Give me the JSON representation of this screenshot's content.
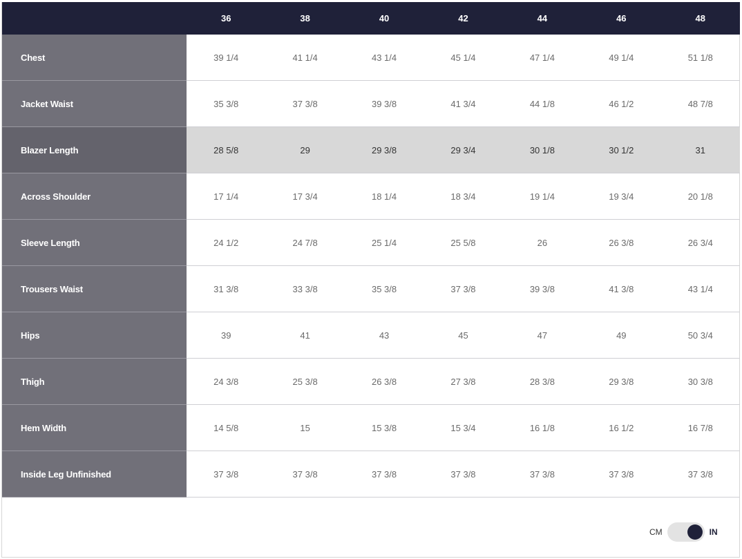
{
  "sizes": [
    "36",
    "38",
    "40",
    "42",
    "44",
    "46",
    "48"
  ],
  "rows": [
    {
      "label": "Chest",
      "values": [
        "39 1/4",
        "41 1/4",
        "43 1/4",
        "45 1/4",
        "47 1/4",
        "49 1/4",
        "51 1/8"
      ]
    },
    {
      "label": "Jacket Waist",
      "values": [
        "35 3/8",
        "37 3/8",
        "39 3/8",
        "41 3/4",
        "44 1/8",
        "46 1/2",
        "48 7/8"
      ]
    },
    {
      "label": "Blazer Length",
      "values": [
        "28 5/8",
        "29",
        "29 3/8",
        "29 3/4",
        "30 1/8",
        "30 1/2",
        "31"
      ]
    },
    {
      "label": "Across Shoulder",
      "values": [
        "17 1/4",
        "17 3/4",
        "18 1/4",
        "18 3/4",
        "19 1/4",
        "19 3/4",
        "20 1/8"
      ]
    },
    {
      "label": "Sleeve Length",
      "values": [
        "24 1/2",
        "24 7/8",
        "25 1/4",
        "25 5/8",
        "26",
        "26 3/8",
        "26 3/4"
      ]
    },
    {
      "label": "Trousers Waist",
      "values": [
        "31 3/8",
        "33 3/8",
        "35 3/8",
        "37 3/8",
        "39 3/8",
        "41 3/8",
        "43 1/4"
      ]
    },
    {
      "label": "Hips",
      "values": [
        "39",
        "41",
        "43",
        "45",
        "47",
        "49",
        "50 3/4"
      ]
    },
    {
      "label": "Thigh",
      "values": [
        "24 3/8",
        "25 3/8",
        "26 3/8",
        "27 3/8",
        "28 3/8",
        "29 3/8",
        "30 3/8"
      ]
    },
    {
      "label": "Hem Width",
      "values": [
        "14 5/8",
        "15",
        "15 3/8",
        "15 3/4",
        "16 1/8",
        "16 1/2",
        "16 7/8"
      ]
    },
    {
      "label": "Inside Leg Unfinished",
      "values": [
        "37 3/8",
        "37 3/8",
        "37 3/8",
        "37 3/8",
        "37 3/8",
        "37 3/8",
        "37 3/8"
      ]
    }
  ],
  "highlighted_row": "Blazer Length",
  "unit_toggle": {
    "left_label": "CM",
    "right_label": "IN",
    "selected": "IN"
  },
  "colors": {
    "header_bg": "#1f2139",
    "label_bg": "#717079",
    "highlight_bg": "#d8d8d8",
    "knob": "#1f2139"
  }
}
